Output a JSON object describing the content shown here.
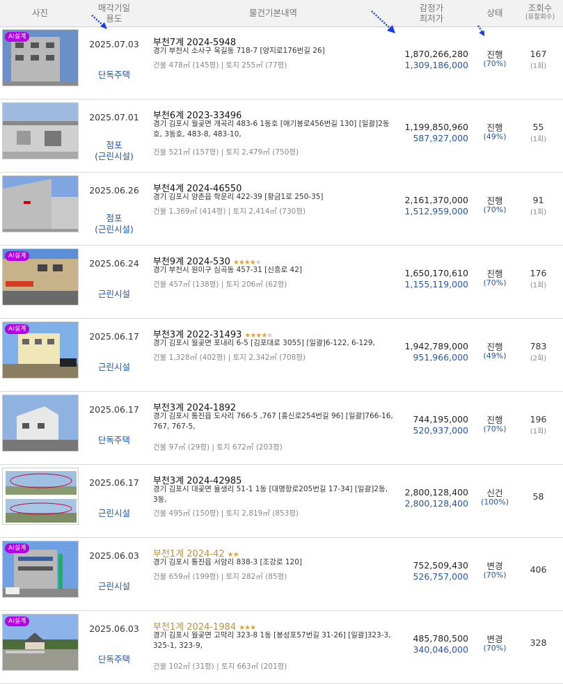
{
  "header": {
    "photo": "사진",
    "date_use_1": "매각기일",
    "date_use_2": "용도",
    "basic": "물건기본내역",
    "price_1": "감정가",
    "price_2": "최저가",
    "status": "상태",
    "views_1": "조회수",
    "views_2": "(유찰회수)"
  },
  "ai_badge": "AI설계",
  "rows": [
    {
      "date": "2025.07.03",
      "usage1": "단독주택",
      "usage2": "",
      "case": "부천7계 2024-5948",
      "gold": false,
      "stars": 0,
      "addr": "경기 부천시 소사구 옥길동 718-7 [양지로176번길 26]",
      "area": "건물 478㎡ (145평)  |  토지 255㎡ (77평)",
      "appraisal": "1,870,266,280",
      "min": "1,309,186,000",
      "status": "진행",
      "pct": "(70%)",
      "views": "167",
      "bids": "(1회)",
      "ai": true,
      "photo": "building-grey"
    },
    {
      "date": "2025.07.01",
      "usage1": "점포",
      "usage2": "(근린시설)",
      "case": "부천6계 2023-33496",
      "gold": false,
      "stars": 0,
      "addr": "경기 김포시 월곶면 개곡리 483-6 1동호 [애기봉로456번길 130] [일괄]2동호, 3동호, 483-8, 483-10,",
      "area": "건물 521㎡ (157평)  |  토지 2,479㎡ (750평)",
      "appraisal": "1,199,850,960",
      "min": "587,927,000",
      "status": "진행",
      "pct": "(49%)",
      "views": "55",
      "bids": "(1회)",
      "ai": false,
      "photo": "warehouse"
    },
    {
      "date": "2025.06.26",
      "usage1": "점포",
      "usage2": "(근린시설)",
      "case": "부천4계 2024-46550",
      "gold": false,
      "stars": 0,
      "addr": "경기 김포시 양촌읍 학운리 422-39 [황금1로 250-35]",
      "area": "건물 1,369㎡ (414평)  |  토지 2,414㎡ (730평)",
      "appraisal": "2,161,370,000",
      "min": "1,512,959,000",
      "status": "진행",
      "pct": "(70%)",
      "views": "91",
      "bids": "(1회)",
      "ai": false,
      "photo": "factory"
    },
    {
      "date": "2025.06.24",
      "usage1": "근린시설",
      "usage2": "",
      "case": "부천9계 2024-530",
      "gold": false,
      "stars": 4,
      "addr": "경기 부천시 원미구 심곡동 457-31 [신흥로 42]",
      "area": "건물 457㎡ (138평)  |  토지 206㎡ (62평)",
      "appraisal": "1,650,170,610",
      "min": "1,155,119,000",
      "status": "진행",
      "pct": "(70%)",
      "views": "176",
      "bids": "(1회)",
      "ai": true,
      "photo": "shop"
    },
    {
      "date": "2025.06.17",
      "usage1": "근린시설",
      "usage2": "",
      "case": "부천3계 2022-31493",
      "gold": false,
      "stars": 4,
      "addr": "경기 김포시 월곶면 포내리 6-5 [김포대로 3055] [일괄]6-122, 6-129,",
      "area": "건물 1,328㎡ (402평)  |  토지 2,342㎡ (708평)",
      "appraisal": "1,942,789,000",
      "min": "951,966,000",
      "status": "진행",
      "pct": "(49%)",
      "views": "783",
      "bids": "(2회)",
      "ai": true,
      "photo": "cream"
    },
    {
      "date": "2025.06.17",
      "usage1": "단독주택",
      "usage2": "",
      "case": "부천3계 2024-1892",
      "gold": false,
      "stars": 0,
      "addr": "경기 김포시 통진읍 도사리 766-5 ,767 [홍신로254번길 96] [일괄]766-16, 767, 767-5,",
      "area": "건물 97㎡ (29평)  |  토지 672㎡ (203평)",
      "appraisal": "744,195,000",
      "min": "520,937,000",
      "status": "진행",
      "pct": "(70%)",
      "views": "196",
      "bids": "(1회)",
      "ai": false,
      "photo": "house"
    },
    {
      "date": "2025.06.17",
      "usage1": "근린시설",
      "usage2": "",
      "case": "부천3계 2024-42985",
      "gold": false,
      "stars": 0,
      "addr": "경기 김포시 대곶면 율생리 51-1 1동 [대명항로205번길 17-34] [일괄]2동, 3동,",
      "area": "건물 495㎡ (150평)  |  토지 2,819㎡ (853평)",
      "appraisal": "2,800,128,400",
      "min": "2,800,128,400",
      "status": "신건",
      "pct": "(100%)",
      "views": "58",
      "bids": "",
      "ai": false,
      "photo": "panorama"
    },
    {
      "date": "2025.06.03",
      "usage1": "근린시설",
      "usage2": "",
      "case": "부천1계 2024-42",
      "gold": true,
      "stars": 2,
      "addr": "경기 김포시 통진읍 서암리 838-3 [조강로 120]",
      "area": "건물 659㎡ (199평)  |  토지 282㎡ (85평)",
      "appraisal": "752,509,430",
      "min": "526,757,000",
      "status": "변경",
      "pct": "(70%)",
      "views": "406",
      "bids": "",
      "ai": true,
      "photo": "commercial"
    },
    {
      "date": "2025.06.03",
      "usage1": "단독주택",
      "usage2": "",
      "case": "부천1계 2024-1984",
      "gold": true,
      "stars": 3,
      "addr": "경기 김포시 월곶면 고막리 323-8 1동 [봉성포57번길 31-26] [일괄]323-3, 325-1, 323-9,",
      "area": "건물 102㎡ (31평)  |  토지 663㎡ (201평)",
      "appraisal": "485,780,500",
      "min": "340,046,000",
      "status": "변경",
      "pct": "(70%)",
      "views": "328",
      "bids": "",
      "ai": true,
      "photo": "rural"
    }
  ],
  "colors": {
    "accent": "#2056b0",
    "gold": "#b7934a",
    "ai": "#b300e6",
    "star": "#d9a730"
  }
}
